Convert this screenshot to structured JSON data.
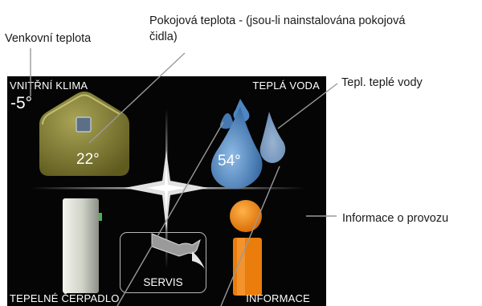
{
  "annotations": {
    "outdoor_temp": "Venkovní teplota",
    "room_temp_line1": "Pokojová teplota - (jsou-li nainstalována pokojová",
    "room_temp_line2": "čidla)",
    "hot_water_temp": "Tepl. teplé vody",
    "operating_info": "Informace o provozu"
  },
  "display": {
    "indoor_climate_label": "VNITŘNÍ KLIMA",
    "hot_water_label": "TEPLÁ VODA",
    "heat_pump_label": "TEPELNÉ ČERPADLO",
    "info_label": "INFORMACE",
    "service_label": "SERVIS",
    "outdoor_temp": "-5°",
    "room_temp": "22°",
    "water_temp": "54°"
  },
  "colors": {
    "screen": "#050505",
    "house": "#7f7b2f",
    "water_drop": "#4a86c0",
    "info_icon": "#f08a12",
    "pump_body": "#d9dcd2"
  },
  "icons": [
    "house-icon",
    "room-sensor-icon",
    "water-drops-icon",
    "heat-pump-icon",
    "wrench-icon",
    "info-icon",
    "star-divider-icon"
  ]
}
